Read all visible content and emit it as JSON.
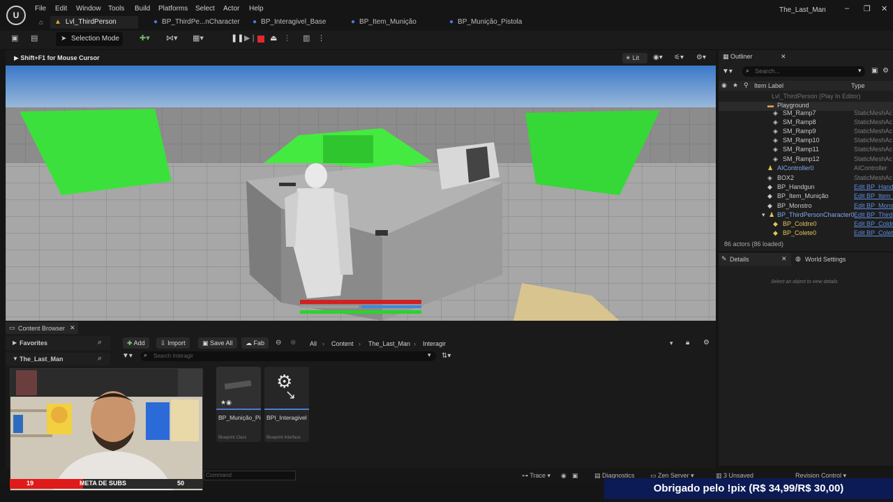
{
  "app": {
    "menus": [
      "File",
      "Edit",
      "Window",
      "Tools",
      "Build",
      "Platforms",
      "Select",
      "Actor",
      "Help"
    ],
    "window_title": "The_Last_Man",
    "logo_text": "U"
  },
  "tabs": [
    {
      "label": "Lvl_ThirdPerson",
      "active": true
    },
    {
      "label": "BP_ThirdPe...nCharacter",
      "active": false
    },
    {
      "label": "BP_Interagivel_Base",
      "active": false
    },
    {
      "label": "BP_Item_Munição",
      "active": false
    },
    {
      "label": "BP_Munição_Pistola",
      "active": false
    }
  ],
  "toolbar": {
    "selection_mode": "Selection Mode"
  },
  "viewport": {
    "hint": "Shift+F1 for Mouse Cursor",
    "view_mode": "Lit"
  },
  "outliner": {
    "title": "Outliner",
    "search_placeholder": "Search...",
    "col_label": "Item Label",
    "col_type": "Type",
    "rows": [
      {
        "label": "Lvl_ThirdPerson (Play In Editor)",
        "type": ""
      },
      {
        "label": "Playground",
        "type": ""
      },
      {
        "label": "SM_Ramp7",
        "type": "StaticMeshAc"
      },
      {
        "label": "SM_Ramp8",
        "type": "StaticMeshAc"
      },
      {
        "label": "SM_Ramp9",
        "type": "StaticMeshAc"
      },
      {
        "label": "SM_Ramp10",
        "type": "StaticMeshAc"
      },
      {
        "label": "SM_Ramp11",
        "type": "StaticMeshAc"
      },
      {
        "label": "SM_Ramp12",
        "type": "StaticMeshAc"
      },
      {
        "label": "AIController0",
        "type": "AIController"
      },
      {
        "label": "BOX2",
        "type": "StaticMeshAc"
      },
      {
        "label": "BP_Handgun",
        "type": "Edit BP_Hand"
      },
      {
        "label": "BP_Item_Munição",
        "type": "Edit BP_Item_"
      },
      {
        "label": "BP_Monstro",
        "type": "Edit BP_Mons"
      },
      {
        "label": "BP_ThirdPersonCharacter0",
        "type": "Edit BP_Third"
      },
      {
        "label": "BP_Coldre0",
        "type": "Edit BP_Coldr"
      },
      {
        "label": "BP_Colete0",
        "type": "Edit BP_Colet"
      }
    ],
    "footer": "86 actors (86 loaded)"
  },
  "details": {
    "tab": "Details",
    "world_settings": "World Settings",
    "empty_text": "Select an object to view details"
  },
  "content_browser": {
    "title": "Content Browser",
    "favorites": "Favorites",
    "project": "The_Last_Man",
    "add": "Add",
    "import": "Import",
    "save_all": "Save All",
    "fab": "Fab",
    "breadcrumb": [
      "All",
      "Content",
      "The_Last_Man",
      "Interagir"
    ],
    "search_placeholder": "Search Interagir",
    "assets": [
      {
        "name": "BP_Munição_Pistola",
        "kind": "Blueprint Class"
      },
      {
        "name": "BPI_Interagivel",
        "kind": "Blueprint Interface"
      }
    ]
  },
  "status": {
    "command": "Command",
    "trace": "Trace",
    "diagnostics": "Diagnostics",
    "zen": "Zen Server",
    "unsaved": "3 Unsaved",
    "revision": "Revision Control"
  },
  "stream": {
    "meta_left": "19",
    "meta_label": "META DE SUBS",
    "meta_right": "50",
    "meta_progress": 0.38,
    "pix_message": "Obrigado pelo !pix (R$ 34,99/R$ 30,00)"
  },
  "colors": {
    "accent_blue": "#4d7bd8",
    "green_mesh": "#39d63a",
    "link_blue": "#5e8ce0",
    "health_red": "#d42020",
    "pix_bg": "#0c1b55"
  }
}
